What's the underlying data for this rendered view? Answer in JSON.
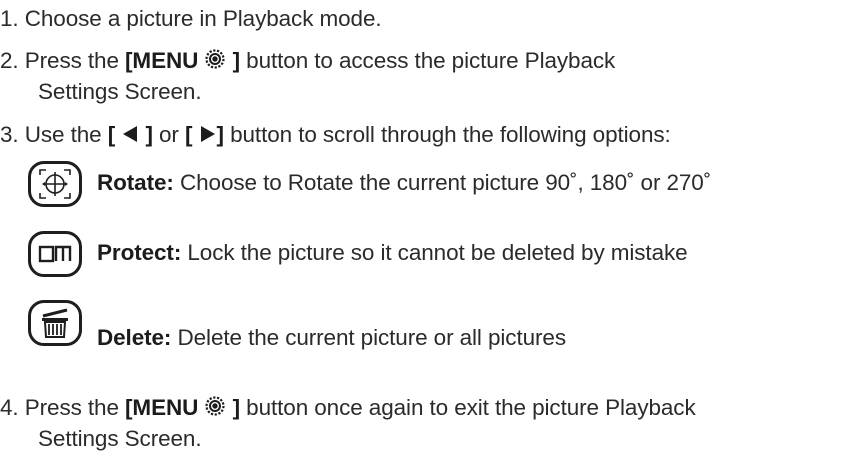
{
  "steps": [
    {
      "num": "1.",
      "text": "Choose a picture in Playback mode."
    },
    {
      "num": "2.",
      "pre": "Press the ",
      "bold": "[MENU",
      "bold_end": "]",
      "post": " button to access the picture Playback",
      "line2": "Settings Screen."
    },
    {
      "num": "3.",
      "pre": "Use the ",
      "left_open": "[",
      "left_close": "]",
      "mid": " or ",
      "right_open": "[",
      "right_close": "]",
      "post": " button to scroll through the following options:"
    },
    {
      "num": "4.",
      "pre": "Press the ",
      "bold": "[MENU",
      "bold_end": "]",
      "post": " button once again to exit the picture Playback",
      "line2": "Settings Screen."
    }
  ],
  "options": [
    {
      "icon": "rotate-icon",
      "title": "Rotate:",
      "desc": " Choose to Rotate the current picture 90˚, 180˚ or 270˚"
    },
    {
      "icon": "protect-icon",
      "title": "Protect:",
      "desc": " Lock the picture so it cannot be deleted by mistake"
    },
    {
      "icon": "delete-icon",
      "title": "Delete:",
      "desc": " Delete the current picture or all pictures"
    }
  ],
  "icons": {
    "menu": "gear-icon",
    "left": "left-arrow-icon",
    "right": "right-arrow-icon"
  }
}
